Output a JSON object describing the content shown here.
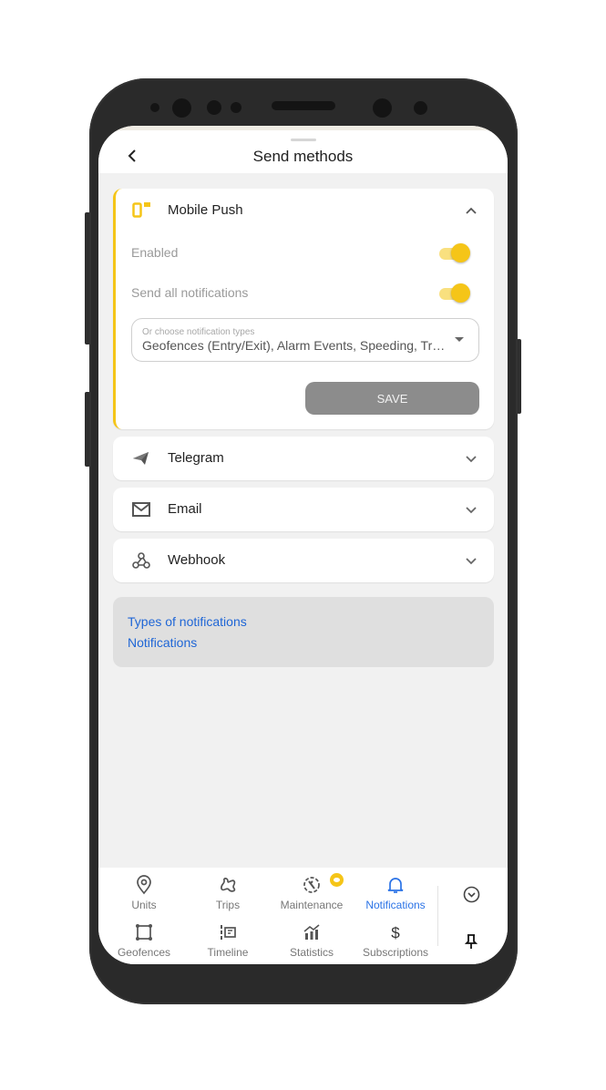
{
  "header": {
    "title": "Send methods",
    "back_icon": "chevron-left-icon"
  },
  "methods": [
    {
      "name": "Mobile Push",
      "icon": "mobile-push-icon",
      "expanded": true,
      "accent": "#f5c518",
      "settings": {
        "enabled_label": "Enabled",
        "enabled": true,
        "send_all_label": "Send all notifications",
        "send_all": true,
        "types_label": "Or choose notification types",
        "types_value": "Geofences (Entry/Exit), Alarm Events, Speeding, Tr…",
        "save_label": "SAVE"
      }
    },
    {
      "name": "Telegram",
      "icon": "telegram-icon",
      "expanded": false
    },
    {
      "name": "Email",
      "icon": "email-icon",
      "expanded": false
    },
    {
      "name": "Webhook",
      "icon": "webhook-icon",
      "expanded": false
    }
  ],
  "links": [
    {
      "label": "Types of notifications"
    },
    {
      "label": "Notifications"
    }
  ],
  "bottom_nav": {
    "items": [
      {
        "label": "Units",
        "icon": "location-pin-icon"
      },
      {
        "label": "Trips",
        "icon": "route-icon"
      },
      {
        "label": "Maintenance",
        "icon": "maintenance-icon",
        "badge": "eye-icon"
      },
      {
        "label": "Notifications",
        "icon": "bell-icon",
        "active": true
      },
      {
        "label": "Geofences",
        "icon": "geofence-square-icon"
      },
      {
        "label": "Timeline",
        "icon": "timeline-icon"
      },
      {
        "label": "Statistics",
        "icon": "statistics-icon"
      },
      {
        "label": "Subscriptions",
        "icon": "dollar-icon"
      }
    ],
    "collapse_icon": "chevron-down-circle-icon",
    "pin_icon": "pin-icon"
  },
  "colors": {
    "accent": "#f5c518",
    "link": "#1f66d6",
    "active_nav": "#2b73e6",
    "save_button": "#8c8c8c"
  }
}
